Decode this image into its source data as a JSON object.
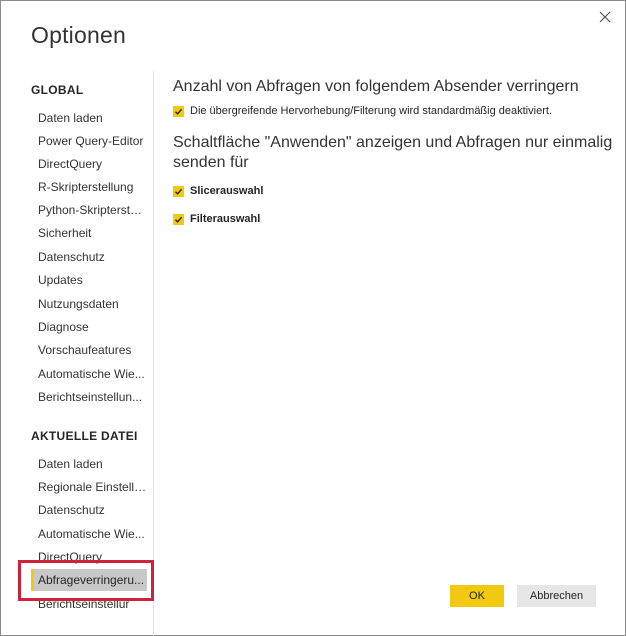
{
  "dialog": {
    "title": "Optionen"
  },
  "sidebar": {
    "global_heading": "GLOBAL",
    "global_items": [
      "Daten laden",
      "Power Query-Editor",
      "DirectQuery",
      "R-Skripterstellung",
      "Python-Skripterstel...",
      "Sicherheit",
      "Datenschutz",
      "Updates",
      "Nutzungsdaten",
      "Diagnose",
      "Vorschaufeatures",
      "Automatische Wie...",
      "Berichtseinstellun..."
    ],
    "file_heading": "AKTUELLE DATEI",
    "file_items": [
      "Daten laden",
      "Regionale Einstellu...",
      "Datenschutz",
      "Automatische Wie...",
      "DirectQuery",
      "Abfrageverringeru...",
      "Berichtseinstellur"
    ],
    "selected_item": "Abfrageverringeru..."
  },
  "content": {
    "section1_heading": "Anzahl von Abfragen von folgendem Absender verringern",
    "section1_option": "Die übergreifende Hervorhebung/Filterung wird standardmäßig deaktiviert.",
    "section1_checked": true,
    "section2_heading": "Schaltfläche \"Anwenden\" anzeigen und Abfragen nur einmalig senden für",
    "section2_options": [
      {
        "label": "Slicerauswahl",
        "checked": true
      },
      {
        "label": "Filterauswahl",
        "checked": true
      }
    ]
  },
  "buttons": {
    "ok": "OK",
    "cancel": "Abbrechen"
  },
  "colors": {
    "accent": "#f2c811",
    "highlight_box": "#d0213a",
    "selected_bg": "#c8c8c8"
  },
  "icons": {
    "close": "close-icon",
    "check": "checkmark-icon"
  }
}
